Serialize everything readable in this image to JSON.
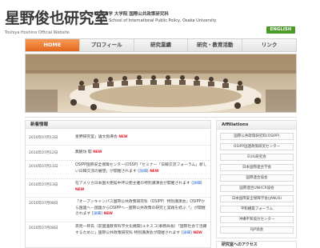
{
  "header": {
    "title": "星野俊也研究室",
    "affiliation_ja": "大阪大学 大学院 国際公共政策研究科",
    "affiliation_en": "Osaka School of International Public Policy, Osaka University",
    "subtitle": "Toshiya Hoshino Official Website",
    "lang_button": "ENGLISH"
  },
  "nav": {
    "items": [
      {
        "label": "HOME",
        "active": true
      },
      {
        "label": "プロフィール",
        "active": false
      },
      {
        "label": "研究業績",
        "active": false
      },
      {
        "label": "研究・教育活動",
        "active": false
      },
      {
        "label": "リンク",
        "active": false
      }
    ]
  },
  "news": {
    "title": "新着情報",
    "new_label": "NEW",
    "detail_label": "詳細",
    "items": [
      {
        "date": "2010年07月13日",
        "text": "星野研究室」論文指導会",
        "new": true
      },
      {
        "date": "2010年07月12日",
        "text": "無観坊 開",
        "new": true
      },
      {
        "date": "2010年07月11日",
        "text": "OSIPP国際安全保障センター(OSSP)「セミナー「日韓交流フォーラム」新しい日韓交流の展望」が開催されます",
        "detail": true,
        "new": true
      },
      {
        "date": "2010年07月13日",
        "text": "在アメリカ日本国大使館中坪公使主催の特別講演会が開催されます",
        "detail": true,
        "new": true
      },
      {
        "date": "2010年07月08日",
        "text": "「オープンキャンパス国際公共政策研究科（OSIPP）特別講演会」OSIPPから国連へ－国連からOSIPPへ－国際公共政策の研究と実践を結ぶ「」が開催されます",
        "detail": true,
        "new": true
      },
      {
        "date": "2010年07月08日",
        "text": "高見一郎氏（前国連教育科学文化機関(ユネスコ)事務局長）「国際社会で活躍するために」国際公共政策研究科 特別講演会が開催されます",
        "detail": true,
        "new": true
      }
    ]
  },
  "affiliations": {
    "title": "Affiliations",
    "items": [
      "国際公共政策研究科(OSIPP)",
      "OSIPP国連政策研究センター",
      "EUIL研究会",
      "日本国際連合学会",
      "国際連合協会",
      "国際連合UNHCR協会",
      "日本国際安全保障学会(JANUS)",
      "平和構築フォーラム",
      "沖縄平和協力センター",
      "RJP協会"
    ]
  },
  "second_box": {
    "title": "研究室へのアクセス"
  },
  "colors": {
    "nav_active": "#e4681f",
    "english_button": "#4c9a2a",
    "new_badge": "#e3202b",
    "detail_link": "#2a6ad8"
  }
}
